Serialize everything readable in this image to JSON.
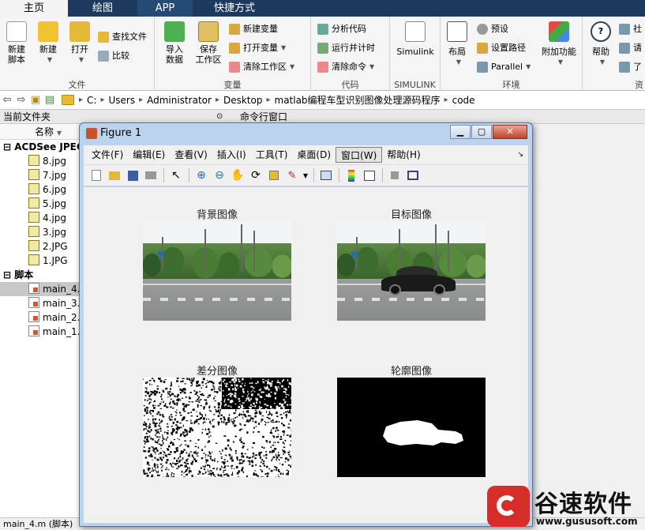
{
  "tabs": [
    "主页",
    "绘图",
    "APP",
    "快捷方式"
  ],
  "ribbon": {
    "file_group": {
      "title": "文件",
      "new_script": "新建\n脚本",
      "new": "新建",
      "open": "打开",
      "find_files": "查找文件",
      "compare": "比较"
    },
    "variable_group": {
      "title": "变量",
      "import": "导入\n数据",
      "save_ws": "保存\n工作区",
      "new_var": "新建变量",
      "open_var": "打开变量",
      "clear_ws": "清除工作区"
    },
    "code_group": {
      "title": "代码",
      "analyze": "分析代码",
      "run_time": "运行并计时",
      "clear_cmd": "清除命令"
    },
    "simulink_group": {
      "title": "SIMULINK",
      "simulink": "Simulink"
    },
    "env_group": {
      "title": "环境",
      "layout": "布局",
      "prefs": "预设",
      "set_path": "设置路径",
      "parallel": "Parallel",
      "addons": "附加功能"
    },
    "resources_group": {
      "title": "资",
      "help": "帮助",
      "community": "社",
      "request": "请",
      "learn": "了"
    }
  },
  "address": [
    "C:",
    "Users",
    "Administrator",
    "Desktop",
    "matlab编程车型识别图像处理源码程序",
    "code"
  ],
  "left_panel": {
    "title": "当前文件夹",
    "col_name": "名称",
    "groups": [
      {
        "label": "ACDSee JPEG",
        "items": [
          "8.jpg",
          "7.jpg",
          "6.jpg",
          "5.jpg",
          "4.jpg",
          "3.jpg",
          "2.JPG",
          "1.JPG"
        ]
      },
      {
        "label": "脚本",
        "items": [
          "main_4.",
          "main_3.",
          "main_2.",
          "main_1."
        ]
      }
    ]
  },
  "cmd_window_title": "命令行窗口",
  "status_bar": "main_4.m  (脚本)",
  "figure": {
    "title": "Figure 1",
    "menus": [
      "文件(F)",
      "编辑(E)",
      "查看(V)",
      "插入(I)",
      "工具(T)",
      "桌面(D)",
      "窗口(W)",
      "帮助(H)"
    ],
    "active_menu_index": 6,
    "subplots": [
      {
        "title": "背景图像",
        "kind": "background"
      },
      {
        "title": "目标图像",
        "kind": "target"
      },
      {
        "title": "差分图像",
        "kind": "difference"
      },
      {
        "title": "轮廓图像",
        "kind": "contour"
      }
    ]
  },
  "watermark": {
    "title": "谷速软件",
    "url": "www.gususoft.com"
  },
  "colors": {
    "tab_bar": "#1d3a5e",
    "matlab_orange": "#d4562c",
    "watermark_red": "#d62d2a"
  }
}
